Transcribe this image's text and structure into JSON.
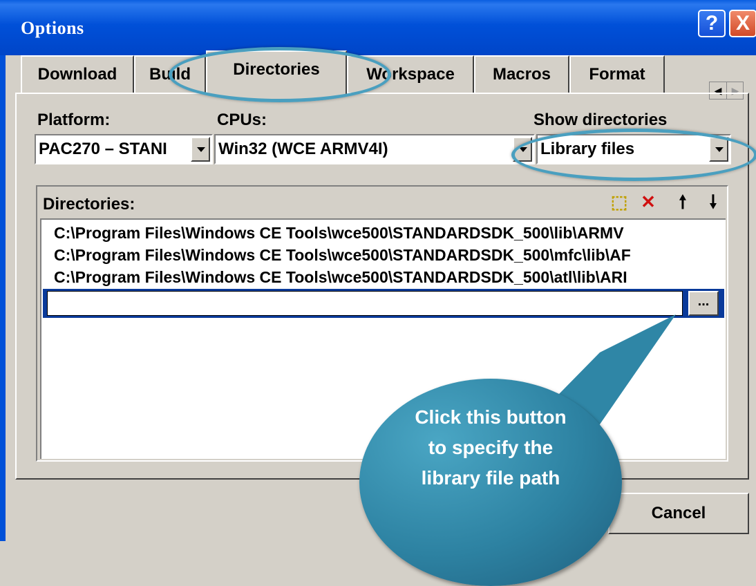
{
  "window": {
    "title": "Options",
    "help_label": "?",
    "close_label": "X"
  },
  "tabs": [
    {
      "label": "Download"
    },
    {
      "label": "Build"
    },
    {
      "label": "Directories"
    },
    {
      "label": "Workspace"
    },
    {
      "label": "Macros"
    },
    {
      "label": "Format"
    }
  ],
  "form": {
    "platform_label": "Platform:",
    "cpus_label": "CPUs:",
    "show_label": "Show directories",
    "platform_value": "PAC270 – STANI",
    "cpus_value": "Win32 (WCE ARMV4I)",
    "show_value": "Library files"
  },
  "directories": {
    "label": "Directories:",
    "items": [
      "C:\\Program Files\\Windows CE Tools\\wce500\\STANDARDSDK_500\\lib\\ARMV",
      "C:\\Program Files\\Windows CE Tools\\wce500\\STANDARDSDK_500\\mfc\\lib\\AF",
      "C:\\Program Files\\Windows CE Tools\\wce500\\STANDARDSDK_500\\atl\\lib\\ARI"
    ],
    "edit_value": "",
    "browse_label": "..."
  },
  "buttons": {
    "cancel_label": "Cancel"
  },
  "callout": {
    "line1": "Click this button",
    "line2": "to specify the",
    "line3": "library file path"
  },
  "colors": {
    "titlebar": "#0050d8",
    "highlight_ring": "#4a9fbf",
    "callout": "#2d82a2"
  }
}
